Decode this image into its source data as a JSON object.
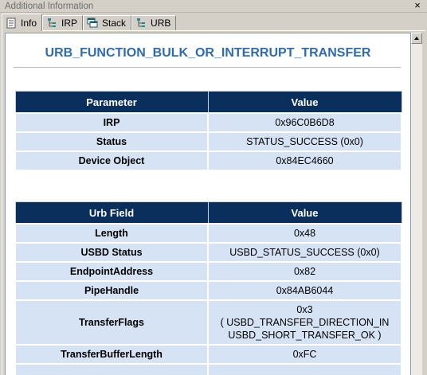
{
  "window": {
    "title": "Additional Information",
    "close_glyph": "×"
  },
  "tabs": [
    {
      "label": "Info",
      "icon": "info-page-icon",
      "active": true
    },
    {
      "label": "IRP",
      "icon": "tree-icon",
      "active": false
    },
    {
      "label": "Stack",
      "icon": "stack-windows-icon",
      "active": false
    },
    {
      "label": "URB",
      "icon": "tree-icon",
      "active": false
    }
  ],
  "heading": "URB_FUNCTION_BULK_OR_INTERRUPT_TRANSFER",
  "param_table": {
    "headers": [
      "Parameter",
      "Value"
    ],
    "rows": [
      {
        "name": "IRP",
        "value": "0x96C0B6D8"
      },
      {
        "name": "Status",
        "value": "STATUS_SUCCESS (0x0)"
      },
      {
        "name": "Device Object",
        "value": "0x84EC4660"
      }
    ]
  },
  "urb_table": {
    "headers": [
      "Urb Field",
      "Value"
    ],
    "rows": [
      {
        "name": "Length",
        "value": "0x48"
      },
      {
        "name": "USBD Status",
        "value": "USBD_STATUS_SUCCESS (0x0)"
      },
      {
        "name": "EndpointAddress",
        "value": "0x82"
      },
      {
        "name": "PipeHandle",
        "value": "0x84AB6044"
      },
      {
        "name": "TransferFlags",
        "value_lines": [
          "0x3",
          "( USBD_TRANSFER_DIRECTION_IN",
          "USBD_SHORT_TRANSFER_OK )"
        ]
      },
      {
        "name": "TransferBufferLength",
        "value": "0xFC"
      }
    ]
  },
  "colors": {
    "heading": "#2e6bb0",
    "table_header_bg": "#0b2f5c",
    "table_cell_bg": "#d6e3f5",
    "window_bg": "#d4d0c8"
  }
}
